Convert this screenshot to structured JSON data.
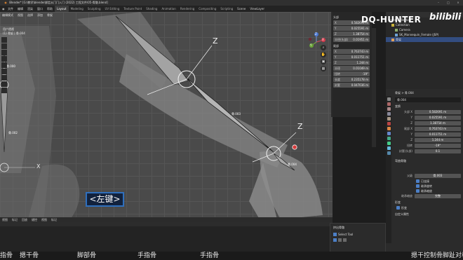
{
  "titlebar": {
    "text": "Blender* [G:\\教学\\blender绑定从门门入门 (2022) 工程文件\\05-骨骼.blend]"
  },
  "menubar": {
    "menus": [
      "文件",
      "编辑",
      "渲染",
      "窗口",
      "帮助"
    ],
    "tabs": [
      "Layout",
      "Modeling",
      "Sculpting",
      "UV Editing",
      "Texture Paint",
      "Shading",
      "Animation",
      "Rendering",
      "Compositing",
      "Scripting"
    ],
    "active_tab": "Layout",
    "scene": "Scene",
    "view_layer": "ViewLayer"
  },
  "viewport": {
    "info_line1": "用户透视",
    "info_line2": "(1) 骨架 | 骨.004",
    "header_items": [
      "编辑模式",
      "视图",
      "选择",
      "添加",
      "骨架"
    ],
    "bottom_items": [
      "视图",
      "标记",
      "回放",
      "键控",
      "视图",
      "标记"
    ],
    "bone_labels": [
      "骨.002",
      "骨.003",
      "骨.004",
      "骨.000"
    ],
    "axis_letter": "Z",
    "x_letter": "X",
    "y_letter": "Y",
    "key_label": "<左键>"
  },
  "npanel": {
    "head_section": "头部",
    "tail_section": "尾部",
    "head": [
      {
        "axis": "X",
        "value": "0.582691 m"
      },
      {
        "axis": "Y",
        "value": "0.025591 m"
      },
      {
        "axis": "Z",
        "value": "1.38754 m"
      }
    ],
    "head_radius_label": "半径(头部)",
    "head_radius": "0.01951 m",
    "tail": [
      {
        "axis": "X",
        "value": "0.763743 m"
      },
      {
        "axis": "Y",
        "value": "0.011751 m"
      },
      {
        "axis": "Z",
        "value": "1.244 m"
      }
    ],
    "tail_radius_label": "半径",
    "tail_radius": "0.01049 m",
    "roll_label": "扭转",
    "roll": "-19°",
    "length_label": "长度",
    "length": "0.235178 m",
    "envelope_label": "封套",
    "envelope": "0.047036 m"
  },
  "nav_gizmo": {
    "z_label": "Z",
    "y_label": "Y",
    "x_label": "X"
  },
  "operator_panel": {
    "title": "挤出骨骼",
    "rows": [
      {
        "label": "Select Tool"
      }
    ]
  },
  "outliner": {
    "header": "Scene Collection",
    "items": [
      {
        "label": "Collection",
        "color": "#c8b23c",
        "selected": false
      },
      {
        "label": "Camera",
        "color": "#8fae6e",
        "selected": false
      },
      {
        "label": "SK_Mannequin_Female (JSP)",
        "color": "#6ea1d6",
        "selected": false
      },
      {
        "label": "骨架",
        "color": "#e0a05a",
        "selected": true
      }
    ]
  },
  "properties": {
    "breadcrumb": "骨架 > 骨.004",
    "bone_name": "骨.004",
    "transform_section": "变换",
    "fields": [
      {
        "label": "头部 X",
        "value": "0.582691 m"
      },
      {
        "label": "Y",
        "value": "0.025591 m"
      },
      {
        "label": "Z",
        "value": "1.38754 m"
      },
      {
        "label": "尾部 X",
        "value": "0.763743 m"
      },
      {
        "label": "Y",
        "value": "0.011751 m"
      },
      {
        "label": "Z",
        "value": "1.244 m"
      },
      {
        "label": "扭转",
        "value": "-19°"
      },
      {
        "label": "封套(头部)",
        "value": "0.1"
      }
    ],
    "relations_section": "弯曲骨骼",
    "parent_label": "父级",
    "parent_value": "骨.003",
    "checks": [
      "已连接",
      "继承旋转",
      "继承缩放"
    ],
    "inherit_mode_label": "继承缩放",
    "inherit_mode": "完整",
    "deform_section": "形变",
    "deform_check": "形变",
    "custom_section": "自定义属性"
  },
  "watermark": {
    "channel": "DQ-HUNTER",
    "site": "bilibili"
  },
  "danmaku": [
    "指骨",
    "摁干骨",
    "脚部骨",
    "手指骨",
    "手指骨",
    "摁干控制骨脚趾对称"
  ],
  "colors": {
    "viewport_bg": "#4a4a4a",
    "selection_blue": "#4c7fc6",
    "key_label_border": "#2f6fbd",
    "cursor_red": "#d63c3c"
  }
}
